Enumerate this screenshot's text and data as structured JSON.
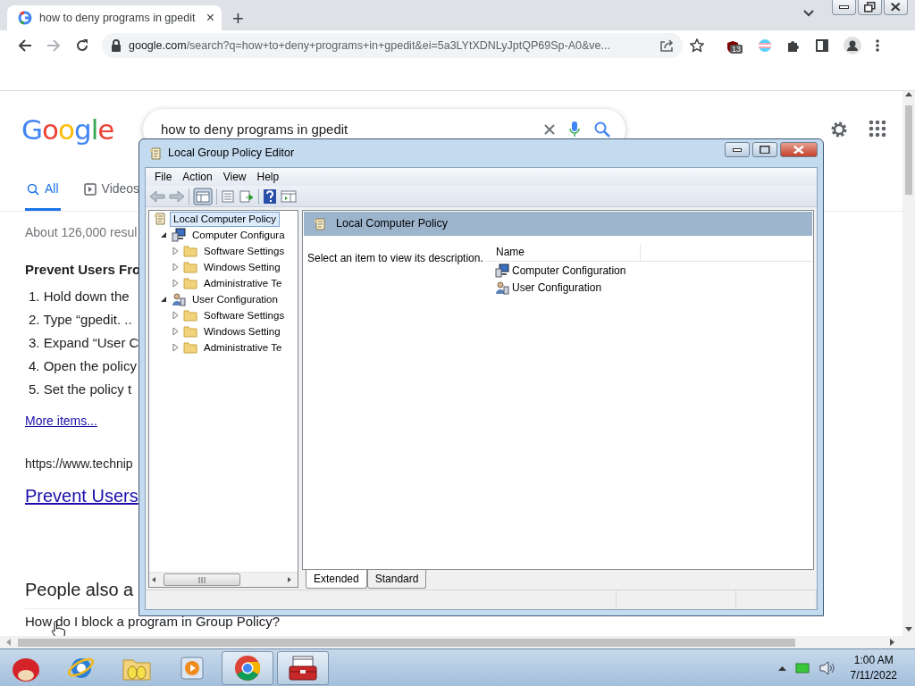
{
  "browser": {
    "tab": {
      "title": "how to deny programs in gpedit",
      "close": "×"
    },
    "new_tab": "+",
    "address": "google.com/search?q=how+to+deny+programs+in+gpedit&ei=5a3LYtXDNLyJptQP69Sp-A0&ve...",
    "extension_badge": "13"
  },
  "search": {
    "logo": "Google",
    "query": "how to deny programs in gpedit",
    "tabs": [
      {
        "label": "All",
        "selected": true
      },
      {
        "label": "Videos",
        "selected": false
      }
    ],
    "result_stats": "About 126,000 resul",
    "snippet_title": "Prevent Users Fro",
    "steps": [
      "1. Hold down the",
      "2. Type “gpedit. ..",
      "3. Expand “User C",
      "4. Open the policy",
      "5. Set the policy t"
    ],
    "more_items": "More items...",
    "result_url": "https://www.technip",
    "result_title": "Prevent Users",
    "people_also_ask": "People also a",
    "question": "How do I block a program in Group Policy?"
  },
  "window": {
    "title": "Local Group Policy Editor",
    "menu": [
      "File",
      "Action",
      "View",
      "Help"
    ],
    "tree": [
      {
        "label": "Local Computer Policy",
        "kind": "policy",
        "selected": true,
        "children": [
          {
            "label": "Computer Configura",
            "kind": "computer",
            "selected": false,
            "expanded": true,
            "children": [
              {
                "label": "Software Settings",
                "kind": "folder",
                "selected": false,
                "expanded": false
              },
              {
                "label": "Windows Setting",
                "kind": "folder",
                "selected": false,
                "expanded": false
              },
              {
                "label": "Administrative Te",
                "kind": "folder",
                "selected": false,
                "expanded": false
              }
            ]
          },
          {
            "label": "User Configuration",
            "kind": "user",
            "selected": false,
            "expanded": true,
            "children": [
              {
                "label": "Software Settings",
                "kind": "folder",
                "selected": false,
                "expanded": false
              },
              {
                "label": "Windows Setting",
                "kind": "folder",
                "selected": false,
                "expanded": false
              },
              {
                "label": "Administrative Te",
                "kind": "folder",
                "selected": false,
                "expanded": false
              }
            ]
          }
        ]
      }
    ],
    "pane_title": "Local Computer Policy",
    "description": "Select an item to view its description.",
    "column": "Name",
    "items": [
      {
        "label": "Computer Configuration",
        "kind": "computer"
      },
      {
        "label": "User Configuration",
        "kind": "user"
      }
    ],
    "view_tabs": [
      {
        "label": "Extended",
        "selected": true
      },
      {
        "label": "Standard",
        "selected": false
      }
    ]
  },
  "taskbar": {
    "apps": [
      {
        "kind": "bird",
        "active": false
      },
      {
        "kind": "ie",
        "active": false
      },
      {
        "kind": "folder",
        "active": false
      },
      {
        "kind": "media",
        "active": false
      },
      {
        "kind": "chrome",
        "active": true
      },
      {
        "kind": "toolbox",
        "active": true
      }
    ],
    "time": "1:00 AM",
    "date": "7/11/2022"
  }
}
